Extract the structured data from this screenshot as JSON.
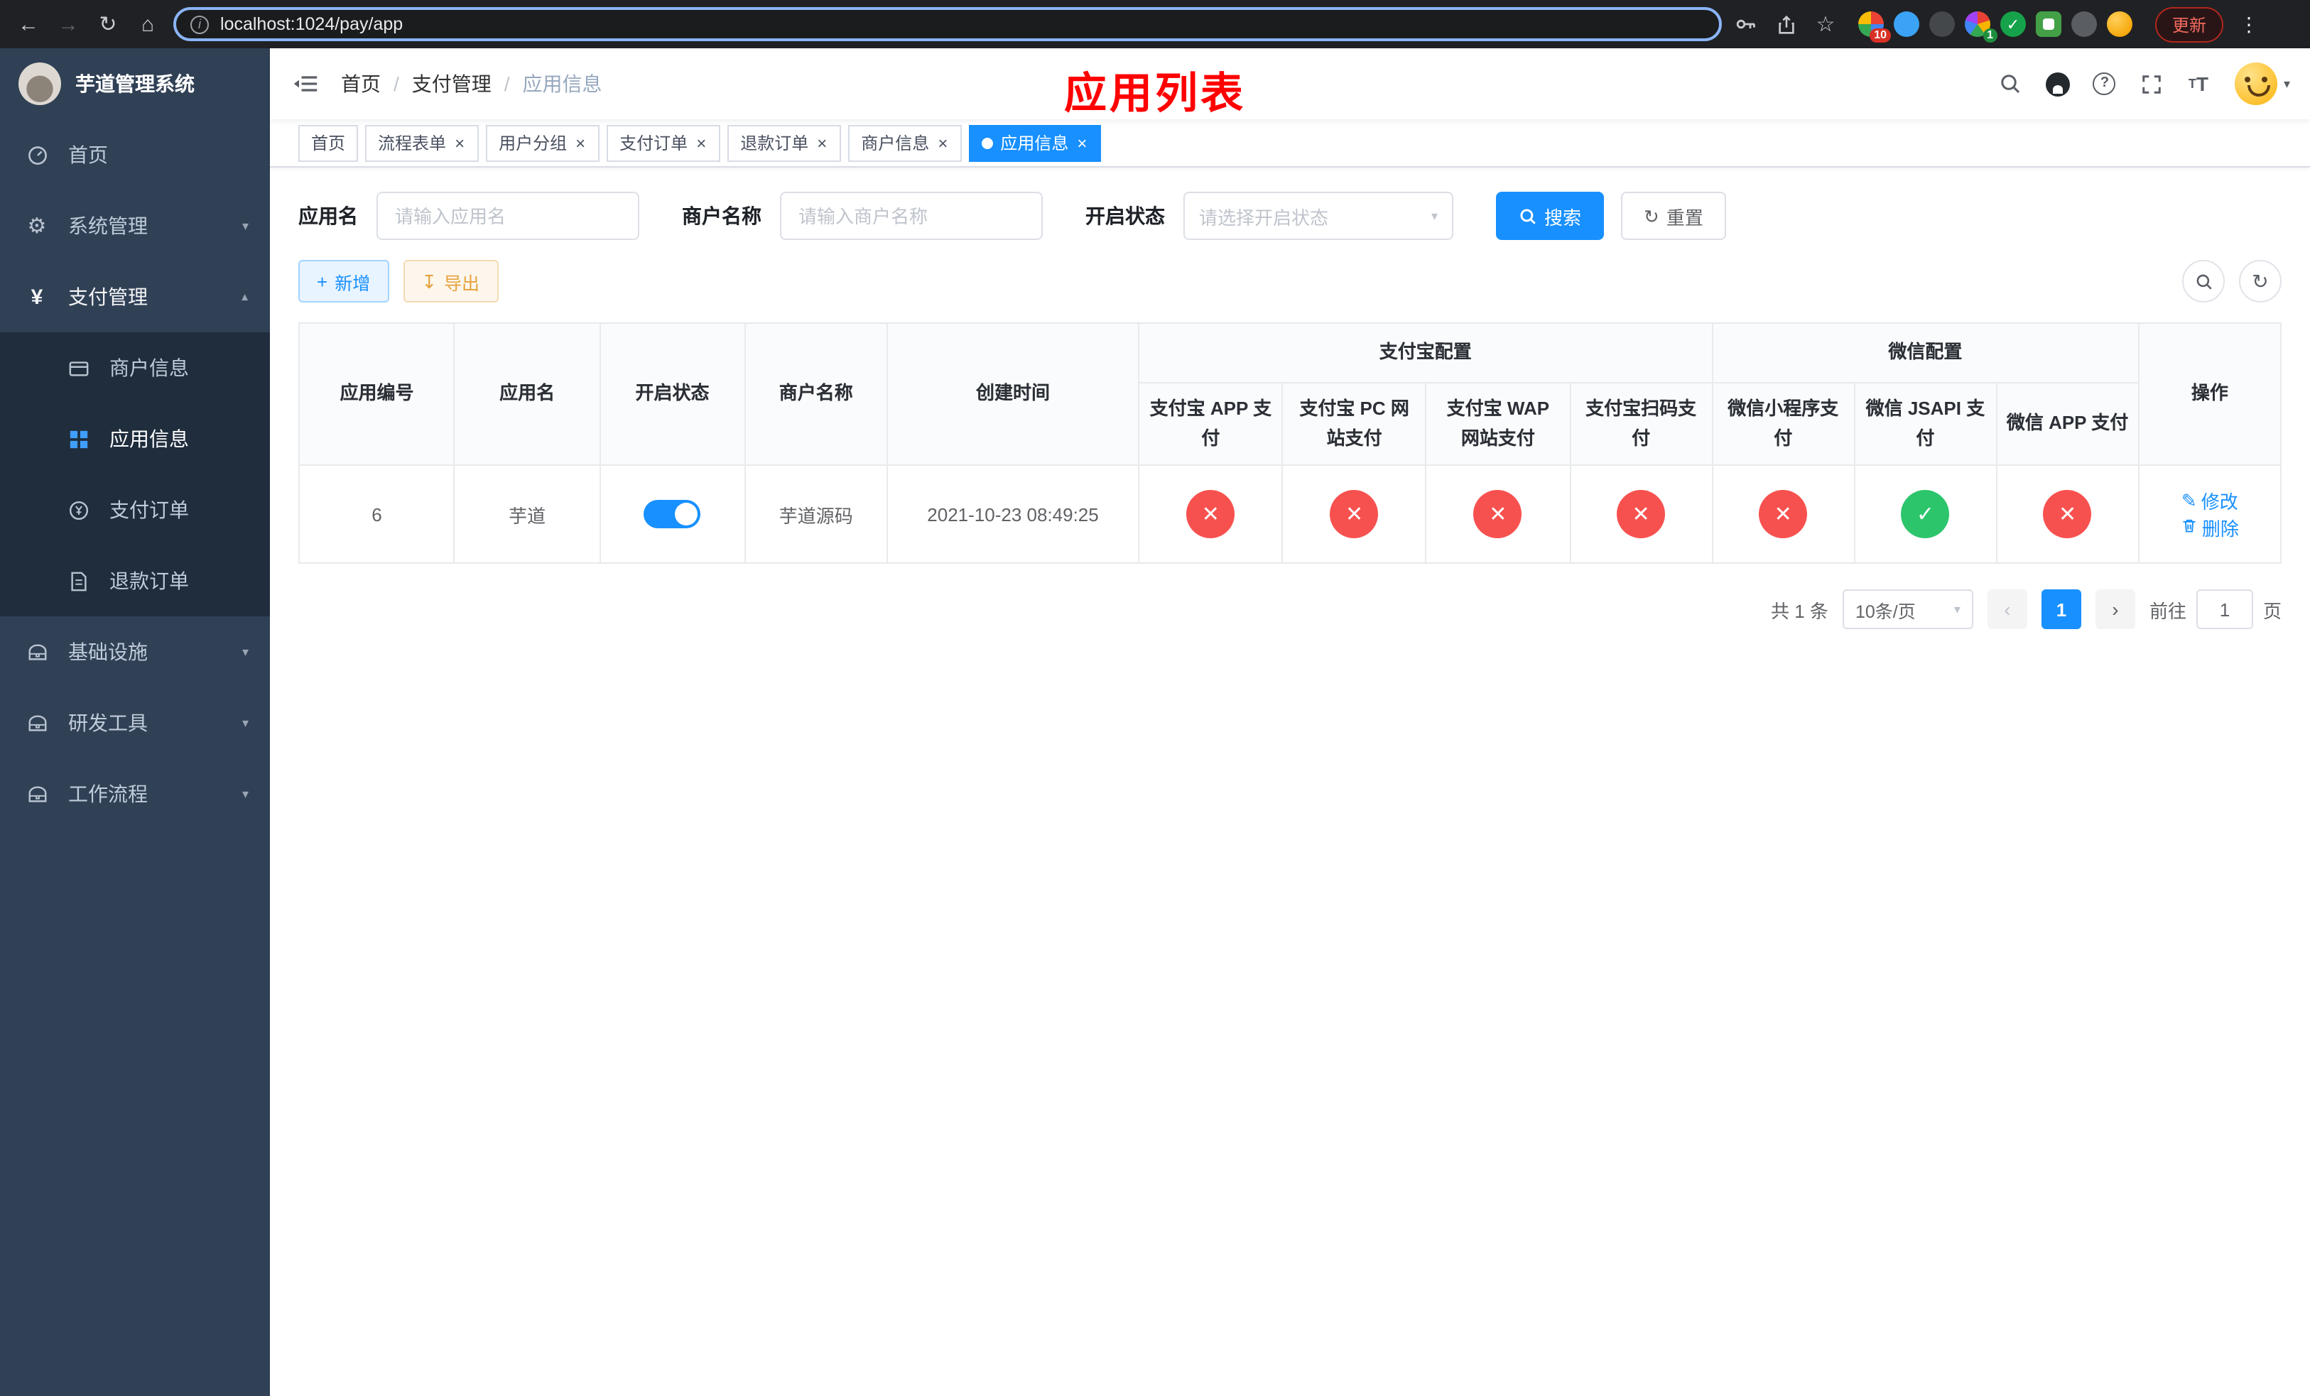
{
  "browser": {
    "url": "localhost:1024/pay/app",
    "update_button": "更新",
    "ext_badge_1": "10",
    "ext_badge_2": "1"
  },
  "sidebar": {
    "title": "芋道管理系统",
    "items": [
      {
        "label": "首页"
      },
      {
        "label": "系统管理"
      },
      {
        "label": "支付管理"
      },
      {
        "label": "商户信息"
      },
      {
        "label": "应用信息"
      },
      {
        "label": "支付订单"
      },
      {
        "label": "退款订单"
      },
      {
        "label": "基础设施"
      },
      {
        "label": "研发工具"
      },
      {
        "label": "工作流程"
      }
    ]
  },
  "header": {
    "breadcrumb": [
      "首页",
      "支付管理",
      "应用信息"
    ],
    "page_title": "应用列表"
  },
  "tabs": {
    "items": [
      {
        "label": "首页"
      },
      {
        "label": "流程表单"
      },
      {
        "label": "用户分组"
      },
      {
        "label": "支付订单"
      },
      {
        "label": "退款订单"
      },
      {
        "label": "商户信息"
      },
      {
        "label": "应用信息"
      }
    ]
  },
  "search": {
    "app_name_label": "应用名",
    "app_name_placeholder": "请输入应用名",
    "merchant_label": "商户名称",
    "merchant_placeholder": "请输入商户名称",
    "status_label": "开启状态",
    "status_placeholder": "请选择开启状态",
    "search_button": "搜索",
    "reset_button": "重置"
  },
  "toolbar": {
    "add_button": "新增",
    "export_button": "导出"
  },
  "table": {
    "headers": {
      "app_no": "应用编号",
      "app_name": "应用名",
      "status": "开启状态",
      "merchant_name": "商户名称",
      "create_time": "创建时间",
      "alipay_group": "支付宝配置",
      "wechat_group": "微信配置",
      "alipay_app": "支付宝 APP 支付",
      "alipay_pc": "支付宝 PC 网站支付",
      "alipay_wap": "支付宝 WAP 网站支付",
      "alipay_qr": "支付宝扫码支付",
      "wechat_lite": "微信小程序支付",
      "wechat_jsapi": "微信 JSAPI 支付",
      "wechat_app": "微信 APP 支付",
      "operation": "操作"
    },
    "rows": [
      {
        "app_no": "6",
        "app_name": "芋道",
        "status": "on",
        "merchant_name": "芋道源码",
        "create_time": "2021-10-23 08:49:25",
        "alipay_app": "disabled",
        "alipay_pc": "disabled",
        "alipay_wap": "disabled",
        "alipay_qr": "disabled",
        "wechat_lite": "disabled",
        "wechat_jsapi": "enabled",
        "wechat_app": "disabled",
        "edit": "修改",
        "delete": "删除"
      }
    ]
  },
  "pagination": {
    "total": "共 1 条",
    "page_size": "10条/页",
    "current_page": "1",
    "goto_prefix": "前往",
    "goto_value": "1",
    "goto_suffix": "页"
  },
  "colors": {
    "primary": "#1890ff",
    "danger": "#f7514f",
    "success": "#2cc56b",
    "title_red": "#ff0000",
    "sidebar_bg": "#304156",
    "submenu_bg": "#1f2d3d"
  }
}
